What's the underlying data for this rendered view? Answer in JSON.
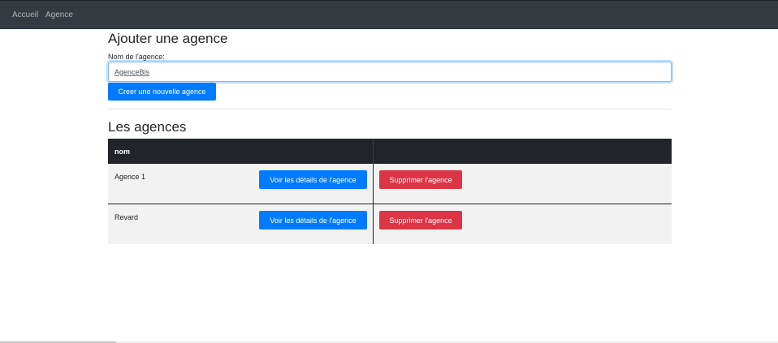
{
  "navbar": {
    "links": [
      "Accueil",
      "Agence"
    ],
    "background": "#343a40"
  },
  "form": {
    "title": "Ajouter une agence",
    "label": "Nom de l'agence:",
    "input_value": "AgenceBis",
    "submit_label": "Creer une nouvelle agence"
  },
  "list": {
    "title": "Les agences",
    "columns": [
      "nom",
      ""
    ],
    "rows": [
      {
        "name": "Agence 1",
        "details_label": "Voir les détails de l'agence",
        "delete_label": "Supprimer l'agence"
      },
      {
        "name": "Revard",
        "details_label": "Voir les détails de l'agence",
        "delete_label": "Supprimer l'agence"
      }
    ]
  },
  "colors": {
    "primary": "#007bff",
    "danger": "#dc3545",
    "table_header": "#212529"
  }
}
